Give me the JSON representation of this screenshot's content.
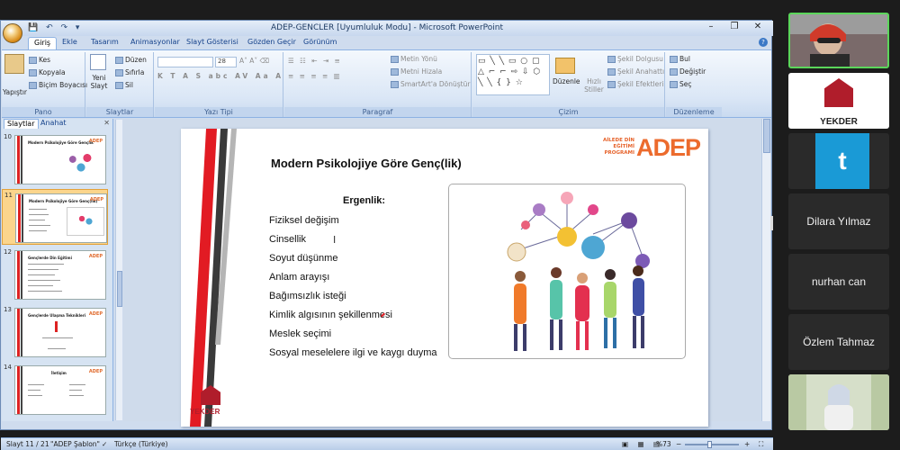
{
  "window": {
    "title": "ADEP-GENCLER [Uyumluluk Modu] - Microsoft PowerPoint",
    "controls": [
      "–",
      "❐",
      "✕"
    ]
  },
  "ribbon_tabs": [
    "Giriş",
    "Ekle",
    "Tasarım",
    "Animasyonlar",
    "Slayt Gösterisi",
    "Gözden Geçir",
    "Görünüm"
  ],
  "ribbon": {
    "pano": {
      "label": "Pano",
      "paste": "Yapıştır",
      "cut": "Kes",
      "copy": "Kopyala",
      "format_painter": "Biçim Boyacısı"
    },
    "slaytlar": {
      "label": "Slaytlar",
      "new_slide": "Yeni Slayt",
      "layout": "Düzen",
      "reset": "Sıfırla",
      "delete": "Sil"
    },
    "yazi_tipi": {
      "label": "Yazı Tipi",
      "font_size": "28"
    },
    "paragraf": {
      "label": "Paragraf",
      "text_direction": "Metin Yönü",
      "align_text": "Metni Hizala",
      "smartart": "SmartArt'a Dönüştür"
    },
    "cizim": {
      "label": "Çizim",
      "arrange": "Düzenle",
      "quick_styles": "Hızlı Stiller",
      "shape_fill": "Şekil Dolgusu",
      "shape_outline": "Şekil Anahattı",
      "shape_effects": "Şekil Efektleri"
    },
    "duzenleme": {
      "label": "Düzenleme",
      "find": "Bul",
      "replace": "Değiştir",
      "select": "Seç"
    }
  },
  "slides_pane": {
    "tabs": [
      "Slaytlar",
      "Anahat"
    ],
    "thumbnails": [
      {
        "num": "10",
        "title": "Modern Psikolojiye Göre Gençlik",
        "selected": false
      },
      {
        "num": "11",
        "title": "Modern Psikolojiye Göre Genç(lik)",
        "selected": true
      },
      {
        "num": "12",
        "title": "Gençlerde Din Eğitimi",
        "selected": false
      },
      {
        "num": "13",
        "title": "Gençlerde Ulaşma Teknikleri",
        "selected": false
      },
      {
        "num": "14",
        "title": "İletişim",
        "selected": false
      }
    ]
  },
  "slide": {
    "title": "Modern Psikolojiye Göre Genç(lik)",
    "subtitle": "Ergenlik:",
    "bullets": [
      "Fiziksel değişim",
      "Cinsellik",
      "Soyut düşünme",
      "Anlam arayışı",
      "Bağımsızlık isteği",
      "Kimlik algısının  şekillenmesi",
      "Meslek seçimi",
      "Sosyal meselelere ilgi  ve kaygı duyma"
    ],
    "logo_small": "AİLEDE DİN EĞİTİMİ PROGRAMI",
    "logo_big": "ADEP",
    "org": "YEKDER",
    "colors": {
      "red": "#e21b23",
      "dark": "#3a3a3a",
      "orange": "#ec6b2d"
    }
  },
  "status": {
    "slide": "Slayt 11 / 21",
    "theme": "\"ADEP Şablon\"",
    "language": "Türkçe (Türkiye)",
    "zoom": "%73"
  },
  "participants": [
    {
      "type": "video",
      "name": "",
      "active": true
    },
    {
      "type": "logo",
      "name": "YEKDER"
    },
    {
      "type": "letter",
      "name": "t"
    },
    {
      "type": "name",
      "name": "Dilara Yılmaz"
    },
    {
      "type": "name",
      "name": "nurhan can"
    },
    {
      "type": "name",
      "name": "Özlem Tahmaz"
    },
    {
      "type": "video",
      "name": ""
    }
  ]
}
